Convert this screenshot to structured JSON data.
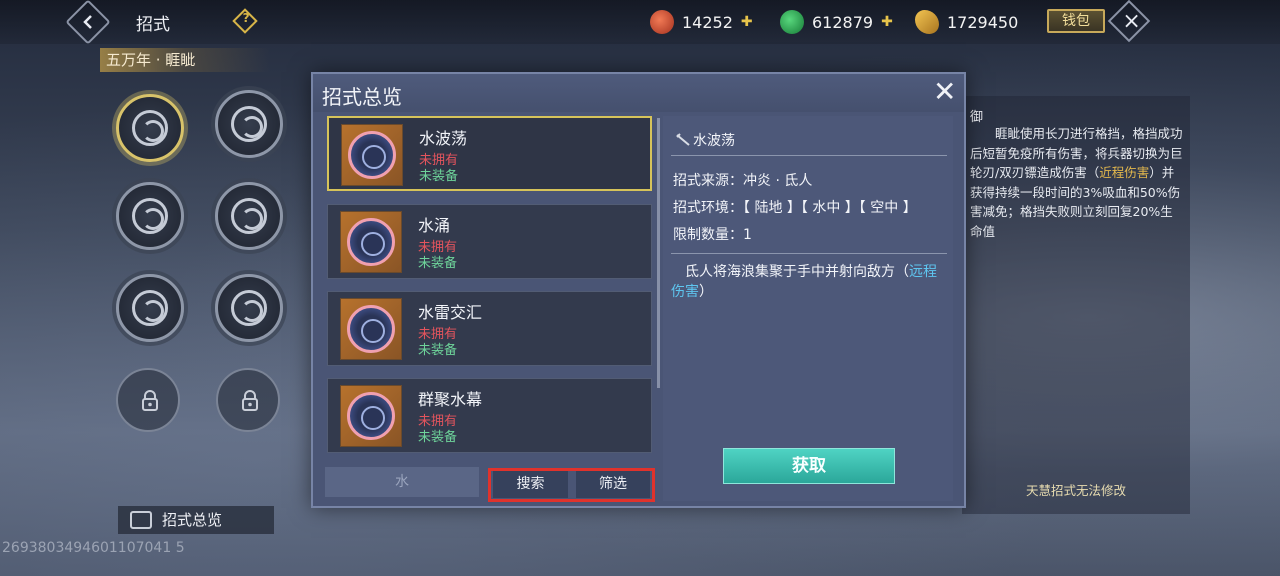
{
  "header": {
    "title": "招式",
    "help_label": "?",
    "currencies": [
      {
        "icon": "red-gem-icon",
        "value": "14252",
        "color": "#c8452b"
      },
      {
        "icon": "jade-coin-icon",
        "value": "612879",
        "color": "#25a34c"
      },
      {
        "icon": "gold-feather-icon",
        "value": "1729450",
        "color": "#d6a43a"
      }
    ],
    "wallet_label": "钱包"
  },
  "left": {
    "realm": "五万年 · 睚眦",
    "overview_label": "招式总览",
    "uid": "2693803494601107041 5"
  },
  "modal": {
    "title": "招式总览",
    "skills": [
      {
        "name": "水波荡",
        "own": "未拥有",
        "equip": "未装备"
      },
      {
        "name": "水涌",
        "own": "未拥有",
        "equip": "未装备"
      },
      {
        "name": "水雷交汇",
        "own": "未拥有",
        "equip": "未装备"
      },
      {
        "name": "群聚水幕",
        "own": "未拥有",
        "equip": "未装备"
      }
    ],
    "filter_value": "水",
    "search_label": "搜索",
    "filter_label": "筛选",
    "detail": {
      "name": "水波荡",
      "source": "招式来源：冲炎 · 氐人",
      "env": "招式环境：【 陆地 】【 水中 】【 空中 】",
      "limit": "限制数量：1",
      "desc_pre": "氐人将海浪集聚于手中并射向敌方（",
      "desc_hl": "远程伤害",
      "desc_post": "）",
      "acquire_label": "获取"
    }
  },
  "right_panel": {
    "title": "御",
    "text_1": "睚眦使用长刀进行格挡，格挡成功后短暂免疫所有伤害，将兵器切换为巨轮刃/双刃镖造成伤害（",
    "text_hl": "近程伤害",
    "text_2": "）并获得持续一段时间的3%吸血和50%伤害减免；格挡失败则立刻回复20%生命值",
    "note": "天慧招式无法修改"
  }
}
